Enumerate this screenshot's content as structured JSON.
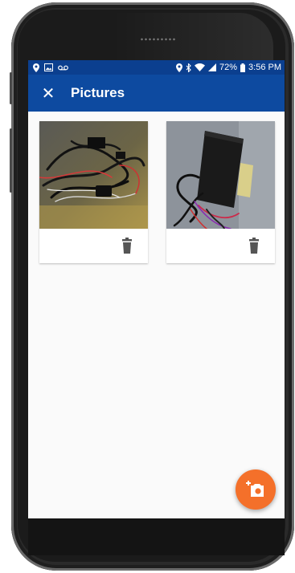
{
  "statusbar": {
    "battery_text": "72%",
    "time": "3:56 PM",
    "left_icons": [
      "location-pin-icon",
      "image-icon",
      "voicemail-icon"
    ],
    "right_icons": [
      "location-pin-icon",
      "bluetooth-icon",
      "wifi-icon",
      "signal-icon",
      "battery-icon"
    ]
  },
  "toolbar": {
    "close_glyph": "✕",
    "title": "Pictures"
  },
  "pictures": [
    {
      "subject": "wiring harness on leather seat",
      "delete_icon": "trash-icon"
    },
    {
      "subject": "black device with wires",
      "delete_icon": "trash-icon"
    }
  ],
  "fab": {
    "icon": "add-photo-icon"
  },
  "colors": {
    "statusbar": "#0b3f8f",
    "toolbar": "#0d4aa0",
    "fab": "#f4702a",
    "background": "#fafafa"
  }
}
